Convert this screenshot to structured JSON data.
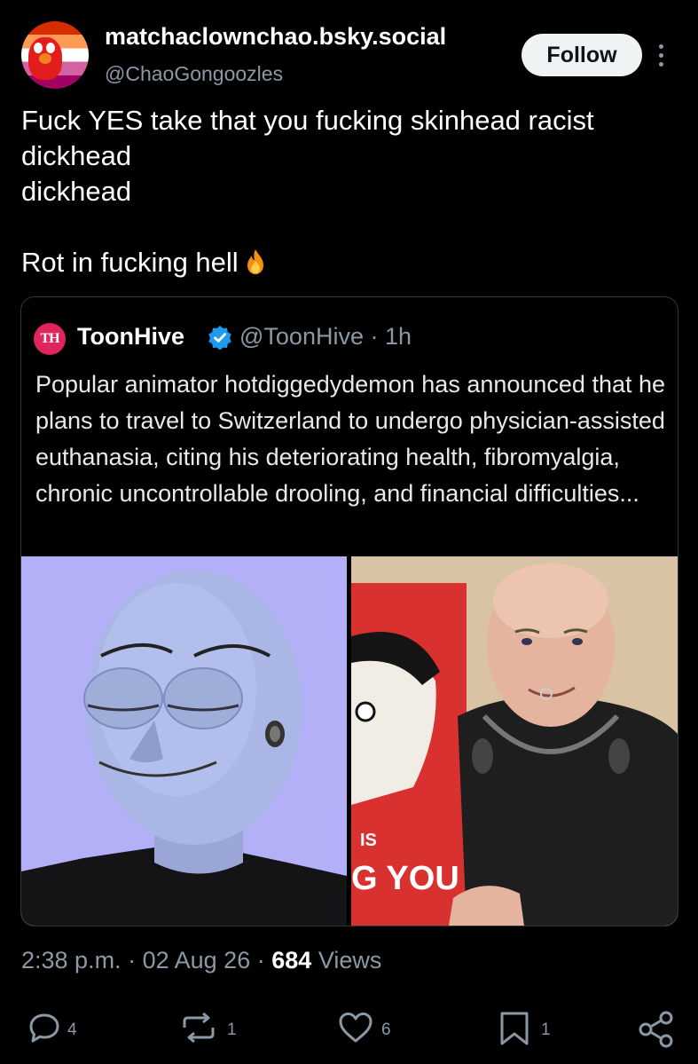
{
  "author": {
    "display_name": "matchaclownchao.bsky.social",
    "handle": "@ChaoGongoozles"
  },
  "follow_label": "Follow",
  "post": {
    "lines": [
      "Fuck YES take that you fucking skinhead racist dickhead",
      "dickhead"
    ],
    "closing": "Rot in fucking hell",
    "emoji": "fire"
  },
  "quoted": {
    "avatar_text": "TH",
    "name": "ToonHive",
    "verified": true,
    "handle": "@ToonHive",
    "separator": "·",
    "time": "1h",
    "text": "Popular animator hotdiggedydemon has announced that he plans to travel to Switzerland to undergo physician-assisted euthanasia, citing his deteriorating health, fibromyalgia, chronic uncontrollable drooling, and financial difficulties...",
    "images": [
      {
        "name": "3d-character-avatar",
        "bg": "#b3b0f7"
      },
      {
        "name": "person-photo",
        "bg": "#d8c4a4",
        "poster_text": [
          "IS",
          "G YOU"
        ]
      }
    ]
  },
  "meta": {
    "time": "2:38 p.m.",
    "separator": "·",
    "date": "02 Aug 26",
    "views_count": "684",
    "views_label": "Views"
  },
  "actions": {
    "replies": "4",
    "reposts": "1",
    "likes": "6",
    "bookmarks": "1"
  },
  "colors": {
    "background": "#000000",
    "text": "#e7e9ea",
    "secondary": "#8b98a5",
    "verified": "#1d9bf0",
    "border": "#333639"
  }
}
